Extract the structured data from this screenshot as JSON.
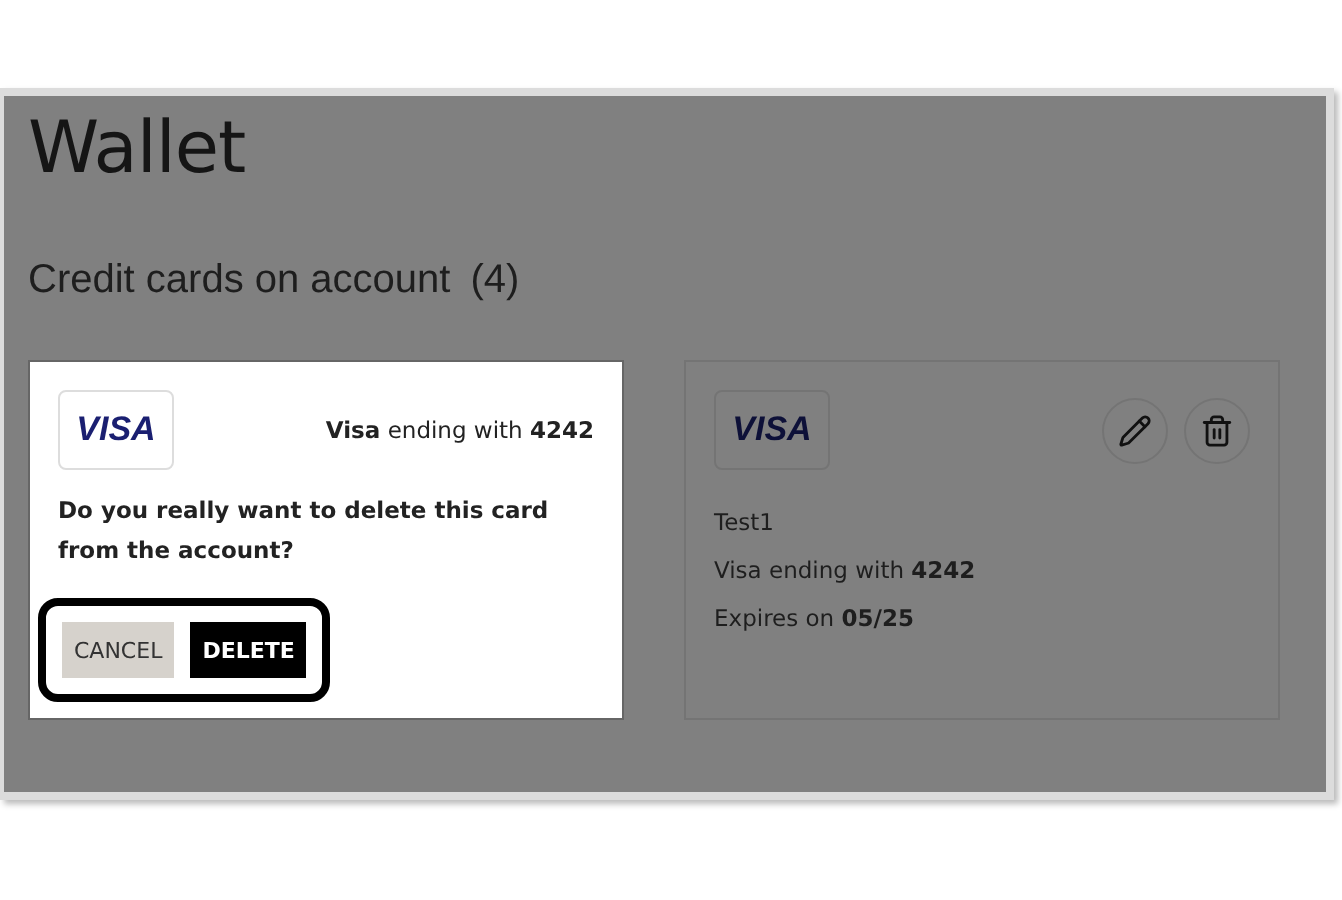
{
  "title": "Wallet",
  "section": {
    "label": "Credit cards on account",
    "count": "(4)"
  },
  "cards": [
    {
      "kind": "confirm",
      "brand": "VISA",
      "summary": "**Visa** ending with **4242**",
      "question": "Do you really want to delete this card from the account?",
      "buttons": [
        {
          "kind": "cancel",
          "label": "CANCEL"
        },
        {
          "kind": "delete",
          "label": "DELETE"
        }
      ],
      "highlighted": true
    },
    {
      "kind": "card",
      "brand": "VISA",
      "name": "Test1",
      "number": "Visa ending with **4242**",
      "expiry": "Expires on **05/25**"
    }
  ]
}
